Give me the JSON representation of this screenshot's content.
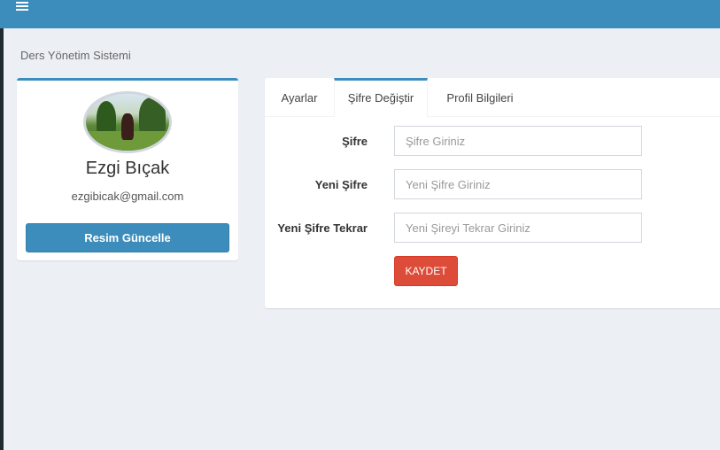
{
  "topbar": {
    "menu_icon": "hamburger-menu-icon",
    "color": "#3c8dbc"
  },
  "breadcrumb": {
    "text": "Ders Yönetim Sistemi"
  },
  "profile": {
    "avatar": "profile-photo",
    "name": "Ezgi Bıçak",
    "email": "ezgibicak@gmail.com",
    "update_button_label": "Resim Güncelle"
  },
  "tabs": [
    {
      "label": "Ayarlar",
      "active": false
    },
    {
      "label": "Şifre Değiştir",
      "active": true
    },
    {
      "label": "Profil Bilgileri",
      "active": false
    }
  ],
  "password_form": {
    "fields": [
      {
        "label": "Şifre",
        "placeholder": "Şifre Giriniz",
        "value": ""
      },
      {
        "label": "Yeni Şifre",
        "placeholder": "Yeni Şifre Giriniz",
        "value": ""
      },
      {
        "label": "Yeni Şifre Tekrar",
        "placeholder": "Yeni Şireyi Tekrar Giriniz",
        "value": ""
      }
    ],
    "save_button_label": "KAYDET"
  },
  "colors": {
    "primary": "#3c8dbc",
    "danger": "#dd4b39",
    "background": "#ecf0f5"
  }
}
